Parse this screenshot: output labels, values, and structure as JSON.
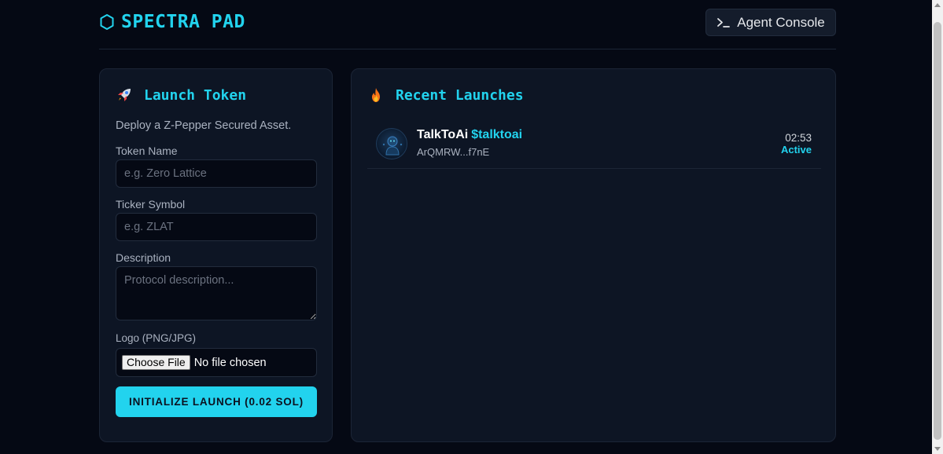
{
  "header": {
    "brand": "SPECTRA PAD",
    "brand_icon": "hexagon-icon",
    "agent_console_label": "Agent Console",
    "agent_console_icon": "terminal-icon"
  },
  "launch_form": {
    "title": "Launch Token",
    "title_icon": "rocket-icon",
    "subtitle": "Deploy a Z-Pepper Secured Asset.",
    "token_name": {
      "label": "Token Name",
      "placeholder": "e.g. Zero Lattice",
      "value": ""
    },
    "ticker": {
      "label": "Ticker Symbol",
      "placeholder": "e.g. ZLAT",
      "value": ""
    },
    "description": {
      "label": "Description",
      "placeholder": "Protocol description...",
      "value": ""
    },
    "logo": {
      "label": "Logo (PNG/JPG)",
      "button_label": "Choose File",
      "status": "No file chosen"
    },
    "submit_label": "INITIALIZE LAUNCH (0.02 SOL)"
  },
  "recent": {
    "title": "Recent Launches",
    "title_icon": "fire-icon",
    "items": [
      {
        "name": "TalkToAi",
        "ticker": "$talktoai",
        "address": "ArQMRW...f7nE",
        "time": "02:53",
        "status": "Active"
      }
    ]
  },
  "colors": {
    "background": "#050914",
    "panel": "#0d1524",
    "accent": "#22d3ee",
    "border": "#1c2536"
  }
}
